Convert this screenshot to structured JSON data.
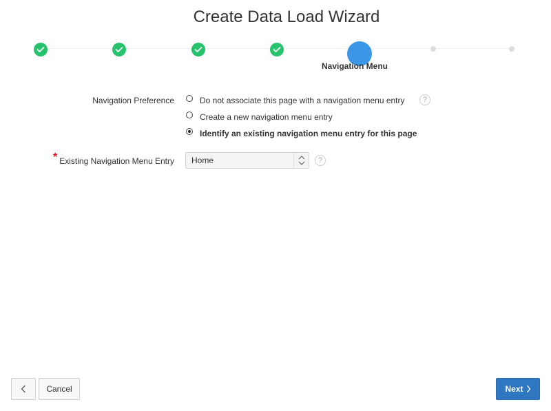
{
  "wizard": {
    "title": "Create Data Load Wizard",
    "current_step_label": "Navigation Menu"
  },
  "steps": [
    {
      "status": "complete",
      "icon": "check-icon"
    },
    {
      "status": "complete",
      "icon": "check-icon"
    },
    {
      "status": "complete",
      "icon": "check-icon"
    },
    {
      "status": "complete",
      "icon": "check-icon"
    },
    {
      "status": "current",
      "label": "Navigation Menu"
    },
    {
      "status": "pending"
    },
    {
      "status": "pending"
    }
  ],
  "form": {
    "navigation_preference": {
      "label": "Navigation Preference",
      "options": [
        {
          "label": "Do not associate this page with a navigation menu entry",
          "selected": false
        },
        {
          "label": "Create a new navigation menu entry",
          "selected": false
        },
        {
          "label": "Identify an existing navigation menu entry for this page",
          "selected": true
        }
      ],
      "help_icon": "?"
    },
    "existing_entry": {
      "label": "Existing Navigation Menu Entry",
      "required_marker": "*",
      "value": "Home",
      "help_icon": "?"
    }
  },
  "footer": {
    "cancel_label": "Cancel",
    "next_label": "Next"
  },
  "colors": {
    "step_complete": "#27c26c",
    "step_current": "#3b96e8",
    "next_button": "#2f77c0",
    "required": "#e0101e"
  }
}
